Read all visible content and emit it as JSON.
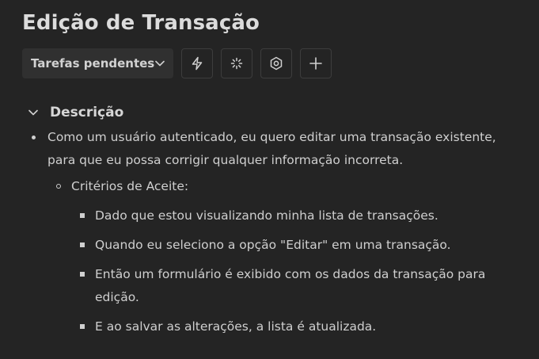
{
  "page": {
    "title": "Edição de Transação"
  },
  "toolbar": {
    "dropdown_label": "Tarefas pendentes",
    "buttons": [
      {
        "icon": "lightning-icon"
      },
      {
        "icon": "loading-spinner-icon"
      },
      {
        "icon": "hexagon-icon"
      },
      {
        "icon": "plus-icon"
      }
    ]
  },
  "section": {
    "title": "Descrição",
    "story": "Como um usuário autenticado, eu quero editar uma transação existente, para que eu possa corrigir qualquer informação incorreta.",
    "criteria_label": "Critérios de Aceite:",
    "criteria": [
      "Dado que estou visualizando minha lista de transações.",
      "Quando eu seleciono a opção \"Editar\" em uma transação.",
      "Então um formulário é exibido com os dados da transação para edição.",
      "E ao salvar as alterações, a lista é atualizada."
    ]
  },
  "colors": {
    "background": "#242424",
    "text": "#cfcfcf",
    "button_border": "#3d3d3d",
    "dropdown_bg": "#303030"
  }
}
